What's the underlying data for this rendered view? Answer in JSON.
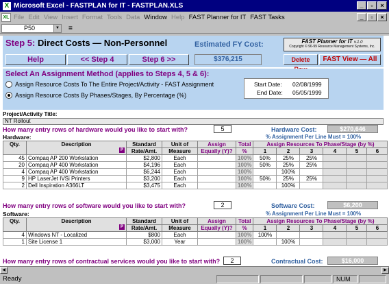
{
  "window": {
    "title": "Microsoft Excel - FASTPLAN for IT - FASTPLAN.XLS"
  },
  "menu": {
    "items": [
      "File",
      "Edit",
      "View",
      "Insert",
      "Format",
      "Tools",
      "Data",
      "Window",
      "Help",
      "FAST Planner for IT",
      "FAST Tasks"
    ]
  },
  "formula": {
    "cell": "P50",
    "eq": "="
  },
  "step": {
    "num": "Step 5:",
    "title": "Direct Costs — Non-Personnel",
    "est_label": "Estimated FY Cost:",
    "est_value": "$376,215",
    "help": "Help",
    "prev": "<< Step 4",
    "next": "Step 6 >>",
    "delete": "Delete Row",
    "view": "FAST View — All"
  },
  "logo": {
    "title": "FAST Planner for IT",
    "ver": "v.1.0",
    "copy": "Copyright © 96-99 Resource Management Systems, Inc."
  },
  "assign": {
    "heading": "Select An Assignment Method (applies to Steps 4, 5 & 6):",
    "opt1": "Assign Resource Costs To The Entire Project/Activity - FAST Assignment",
    "opt2": "Assign Resource Costs By Phases/Stages, By Percentage (%)",
    "start_label": "Start Date:",
    "start": "02/08/1999",
    "end_label": "End Date:",
    "end": "05/05/1999"
  },
  "project": {
    "label": "Project/Activity Title:",
    "value": "NT Rollout"
  },
  "hardware": {
    "question": "How many entry rows of hardware would you like to start with?",
    "rows": "5",
    "cost_label": "Hardware Cost:",
    "cost": "$270,646",
    "section": "Hardware:",
    "pct_note": "% Assignment Per Line Must = 100%",
    "data": [
      {
        "qty": "45",
        "desc": "Compaq AP 200 Workstation",
        "rate": "$2,800",
        "unit": "Each",
        "tot": "100%",
        "p1": "50%",
        "p2": "25%",
        "p3": "25%"
      },
      {
        "qty": "20",
        "desc": "Compaq AP 400 Workstation",
        "rate": "$4,196",
        "unit": "Each",
        "tot": "100%",
        "p1": "50%",
        "p2": "25%",
        "p3": "25%"
      },
      {
        "qty": "4",
        "desc": "Compaq AP 400 Workstation",
        "rate": "$6,244",
        "unit": "Each",
        "tot": "100%",
        "p1": "",
        "p2": "100%",
        "p3": ""
      },
      {
        "qty": "9",
        "desc": "HP LaserJet IVSi Printers",
        "rate": "$3,200",
        "unit": "Each",
        "tot": "100%",
        "p1": "50%",
        "p2": "25%",
        "p3": "25%"
      },
      {
        "qty": "2",
        "desc": "Dell Inspiration A366LT",
        "rate": "$3,475",
        "unit": "Each",
        "tot": "100%",
        "p1": "",
        "p2": "100%",
        "p3": ""
      }
    ]
  },
  "software": {
    "question": "How many entry rows of software would you like to start with?",
    "rows": "2",
    "cost_label": "Software Cost:",
    "cost": "$6,200",
    "section": "Software:",
    "pct_note": "% Assignment Per Line Must = 100%",
    "data": [
      {
        "qty": "4",
        "desc": "Windows NT - Localized",
        "rate": "$800",
        "unit": "Each",
        "tot": "100%",
        "p1": "100%",
        "p2": "",
        "p3": ""
      },
      {
        "qty": "1",
        "desc": "Site License 1",
        "rate": "$3,000",
        "unit": "Year",
        "tot": "100%",
        "p1": "",
        "p2": "100%",
        "p3": ""
      }
    ]
  },
  "contract": {
    "question": "How many entry rows of contractual services would you like to start with?",
    "rows": "2",
    "cost_label": "Contractual Cost:",
    "cost": "$16,000"
  },
  "headers": {
    "qty": "Qty.",
    "desc": "Description",
    "rate1": "Standard",
    "rate2": "Rate/Amt.",
    "unit1": "Unit of",
    "unit2": "Measure",
    "asg1": "Assign",
    "asg2": "Equally (Y)?",
    "tot1": "Total",
    "tot2": "%",
    "phase": "Assign Resources To Phase/Stage (by %)",
    "n1": "1",
    "n2": "2",
    "n3": "3",
    "n4": "4",
    "n5": "5",
    "n6": "6",
    "p": "P"
  },
  "status": {
    "text": "Ready",
    "num": "NUM"
  }
}
